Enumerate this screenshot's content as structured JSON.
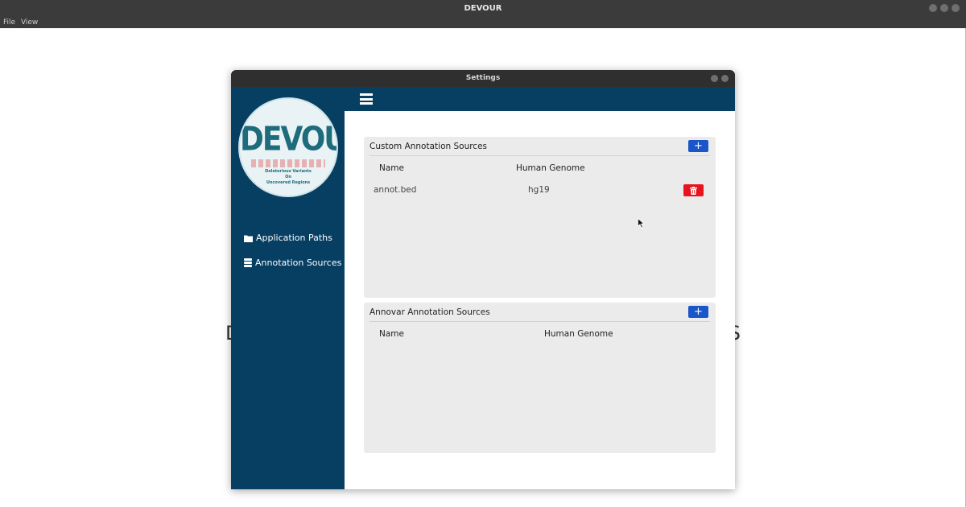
{
  "app": {
    "title": "DEVOUR",
    "menu": [
      "File",
      "View"
    ]
  },
  "background": {
    "left_fragment": "D",
    "right_fragment": "S"
  },
  "dialog": {
    "title": "Settings"
  },
  "logo": {
    "word": "DEVOUR",
    "subtitle_lines": [
      "Deleterious Variants",
      "On",
      "Uncovered Regions"
    ]
  },
  "sidebar": {
    "items": [
      {
        "label": "Application Paths",
        "icon": "folder-icon"
      },
      {
        "label": "Annotation Sources",
        "icon": "database-icon"
      }
    ]
  },
  "custom_panel": {
    "title": "Custom Annotation Sources",
    "add_label": "+",
    "columns": [
      "Name",
      "Human Genome"
    ],
    "rows": [
      {
        "name": "annot.bed",
        "genome": "hg19"
      }
    ]
  },
  "annovar_panel": {
    "title": "Annovar Annotation Sources",
    "add_label": "+",
    "columns": [
      "Name",
      "Human Genome"
    ],
    "rows": []
  },
  "colors": {
    "sidebar": "#073f63",
    "add_button": "#1a56c9",
    "delete_button": "#e8141d",
    "panel_bg": "#ebebeb"
  }
}
